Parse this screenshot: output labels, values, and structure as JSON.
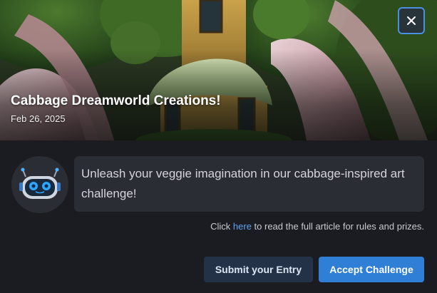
{
  "banner": {
    "title": "Cabbage Dreamworld Creations!",
    "date": "Feb 26, 2025"
  },
  "close": {
    "icon": "close-icon"
  },
  "message": {
    "avatar_icon": "robot-icon",
    "text": "Unleash your veggie imagination in our cabbage-inspired art challenge!"
  },
  "note": {
    "prefix": "Click ",
    "link": "here",
    "suffix": " to read the full article for rules and prizes."
  },
  "actions": {
    "submit_label": "Submit your Entry",
    "accept_label": "Accept Challenge"
  },
  "colors": {
    "background": "#1b1c22",
    "panel": "#2b2d35",
    "accent": "#2f7fd6",
    "link": "#5ea2ee",
    "secondary_button": "#233247"
  }
}
